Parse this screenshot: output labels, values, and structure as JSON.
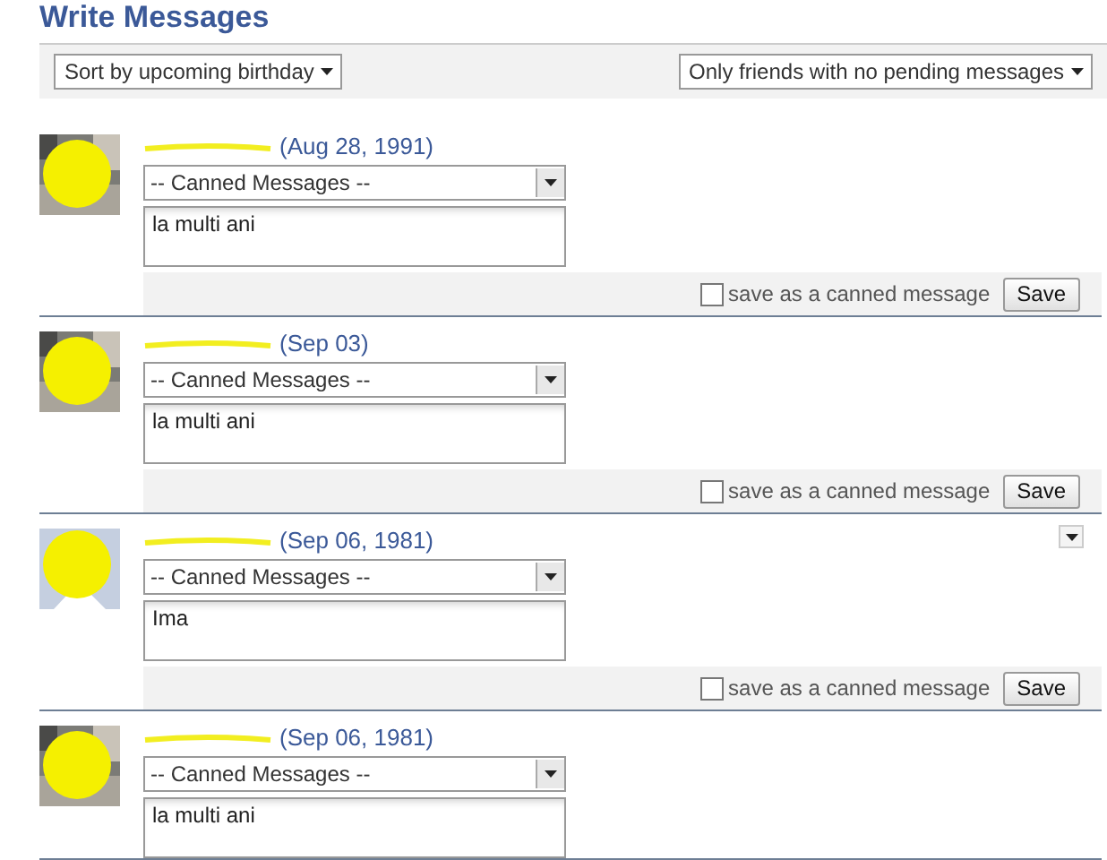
{
  "title": "Write Messages",
  "toolbar": {
    "sort": "Sort by upcoming birthday",
    "filter": "Only friends with no pending messages"
  },
  "friends": [
    {
      "kind": "photo",
      "date": "(Aug 28, 1991)",
      "canned": "-- Canned Messages --",
      "message": "la multi ani",
      "save_canned": "save as a canned message",
      "save_checked": false,
      "save": "Save",
      "menu": false
    },
    {
      "kind": "photo",
      "date": "(Sep 03)",
      "canned": "-- Canned Messages --",
      "message": "la multi ani",
      "save_canned": "save as a canned message",
      "save_checked": false,
      "save": "Save",
      "menu": false
    },
    {
      "kind": "default",
      "date": "(Sep 06, 1981)",
      "canned": "-- Canned Messages --",
      "message": "Ima",
      "save_canned": "save as a canned message",
      "save_checked": false,
      "save": "Save",
      "menu": true
    },
    {
      "kind": "photo",
      "date": "(Sep 06, 1981)",
      "canned": "-- Canned Messages --",
      "message": "la multi ani"
    }
  ]
}
